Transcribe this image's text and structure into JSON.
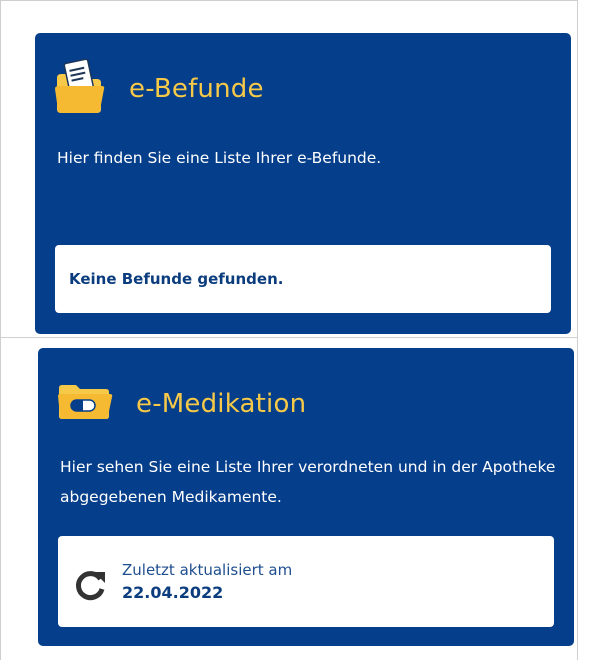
{
  "befunde": {
    "title": "e-Befunde",
    "icon": "folder-document-icon",
    "description": "Hier finden Sie eine Liste Ihrer e-Befunde.",
    "empty_message": "Keine Befunde gefunden."
  },
  "medikation": {
    "title": "e-Medikation",
    "icon": "medication-folder-icon",
    "description": "Hier sehen Sie eine Liste Ihrer verordneten und in der Apotheke abgegebenen Medikamente.",
    "updated_label": "Zuletzt aktualisiert am",
    "updated_date": "22.04.2022",
    "refresh_icon": "refresh-icon"
  },
  "colors": {
    "card_background": "#053e8a",
    "title_accent": "#f7c948",
    "text_on_card": "#ffffff",
    "inner_text": "#0b3d7e"
  }
}
